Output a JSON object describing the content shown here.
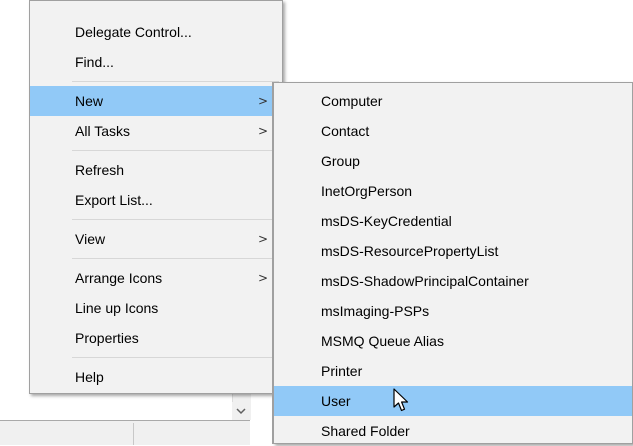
{
  "context_menu": {
    "groups": [
      [
        {
          "label": "Delegate Control...",
          "submenu": false
        },
        {
          "label": "Find...",
          "submenu": false
        }
      ],
      [
        {
          "label": "New",
          "submenu": true,
          "highlighted": true
        },
        {
          "label": "All Tasks",
          "submenu": true
        }
      ],
      [
        {
          "label": "Refresh",
          "submenu": false
        },
        {
          "label": "Export List...",
          "submenu": false
        }
      ],
      [
        {
          "label": "View",
          "submenu": true
        }
      ],
      [
        {
          "label": "Arrange Icons",
          "submenu": true
        },
        {
          "label": "Line up Icons",
          "submenu": false
        },
        {
          "label": "Properties",
          "submenu": false
        }
      ],
      [
        {
          "label": "Help",
          "submenu": false
        }
      ]
    ],
    "submenu_arrow": ">"
  },
  "new_submenu": {
    "items": [
      {
        "label": "Computer"
      },
      {
        "label": "Contact"
      },
      {
        "label": "Group"
      },
      {
        "label": "InetOrgPerson"
      },
      {
        "label": "msDS-KeyCredential"
      },
      {
        "label": "msDS-ResourcePropertyList"
      },
      {
        "label": "msDS-ShadowPrincipalContainer"
      },
      {
        "label": "msImaging-PSPs"
      },
      {
        "label": "MSMQ Queue Alias"
      },
      {
        "label": "Printer"
      },
      {
        "label": "User",
        "highlighted": true
      },
      {
        "label": "Shared Folder"
      }
    ]
  },
  "colors": {
    "menu_background": "#f2f2f2",
    "highlight": "#91c9f7",
    "border": "#a0a0a0"
  },
  "icons": {
    "cursor": "arrow-pointer-icon",
    "scroll_down": "chevron-down-icon"
  }
}
